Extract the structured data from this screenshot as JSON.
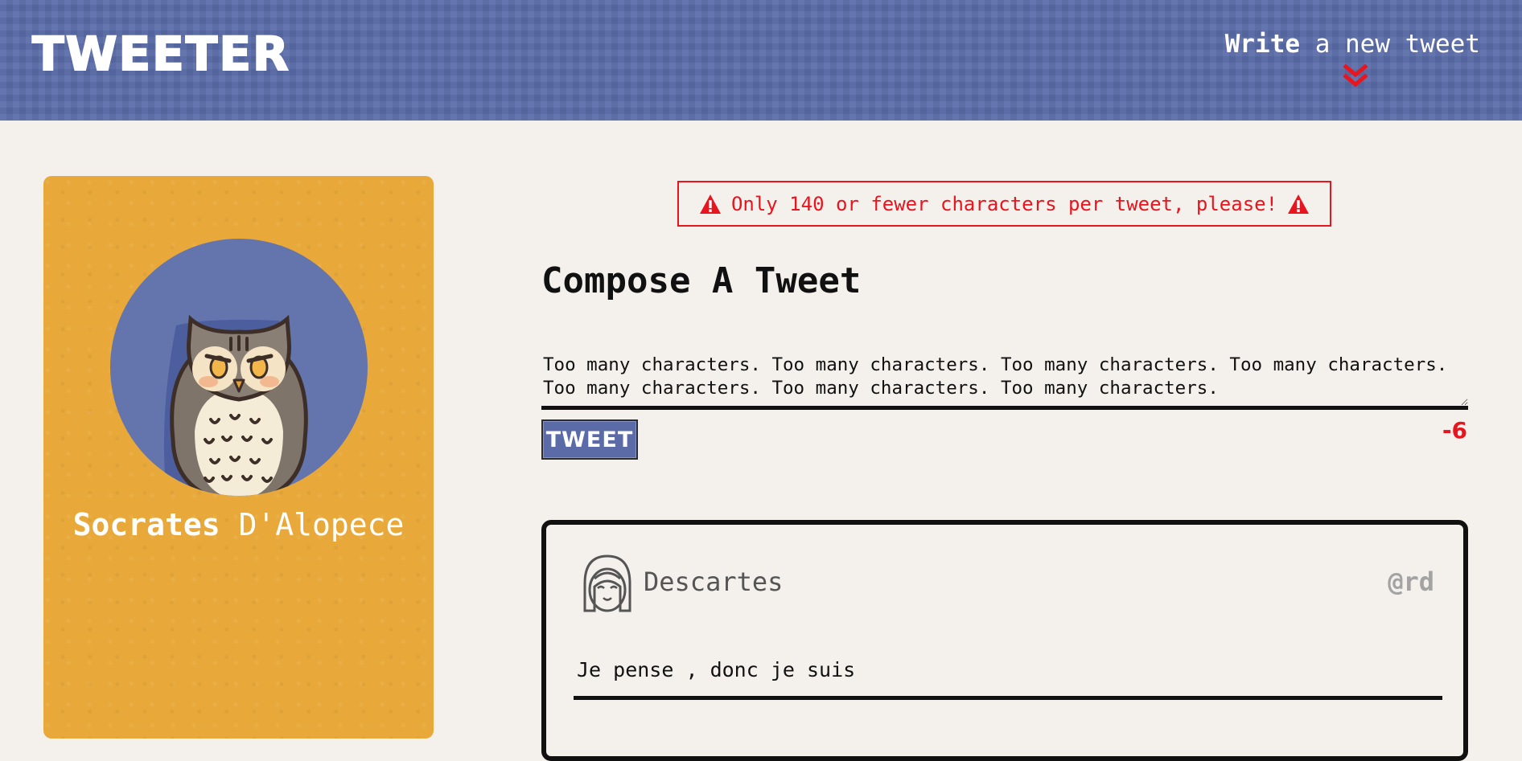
{
  "header": {
    "logo": "TWEETER",
    "nav_write_bold": "Write",
    "nav_write_rest": " a new tweet",
    "nav_icon": "double-chevron-down-icon",
    "nav_icon_color": "#e8141e"
  },
  "profile": {
    "first_name": "Socrates",
    "last_name": " D'Alopece",
    "avatar_icon": "owl-avatar-icon",
    "card_color": "#e8a93a"
  },
  "error": {
    "message": "Only 140 or fewer characters per tweet, please!",
    "icon": "warning-triangle-icon",
    "color": "#e8141e"
  },
  "compose": {
    "title": "Compose A Tweet",
    "text": "Too many characters. Too many characters. Too many characters. Too many characters. Too many characters. Too many characters. Too many characters.",
    "button_label": "TWEET",
    "counter": "-6"
  },
  "tweets": [
    {
      "author": "Descartes",
      "handle": "@rd",
      "avatar_icon": "smiling-face-avatar-icon",
      "content": "Je pense , donc je suis"
    }
  ],
  "colors": {
    "header_bg": "#5a6ba8",
    "page_bg": "#f4f1ec",
    "error_red": "#e8141e"
  }
}
